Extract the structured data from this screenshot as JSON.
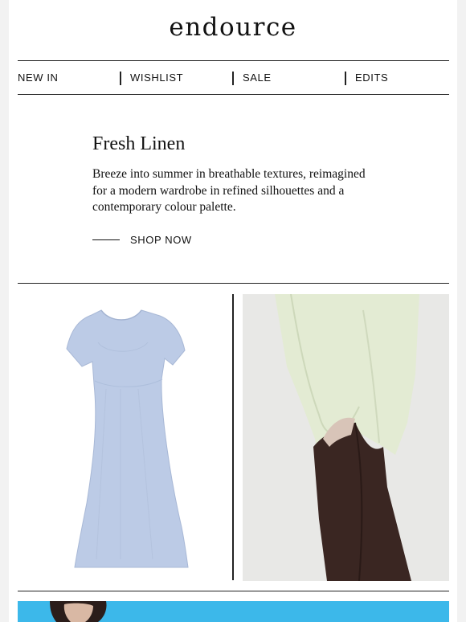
{
  "brand": {
    "logo": "endource"
  },
  "nav": {
    "items": [
      {
        "label": "NEW IN"
      },
      {
        "label": "WISHLIST"
      },
      {
        "label": "SALE"
      },
      {
        "label": "EDITS"
      }
    ]
  },
  "hero": {
    "title": "Fresh Linen",
    "body": "Breeze into summer in breathable textures, reimagined for a modern wardrobe in refined silhouettes and a contemporary colour palette.",
    "cta": "SHOP NOW"
  },
  "products": [
    {
      "image": "blue-linen-midi-dress",
      "color": "#bccbe6"
    },
    {
      "image": "model-pale-green-linen-shirt-brown-trousers",
      "shirt_color": "#e3ebd3",
      "trouser_color": "#3a2622"
    }
  ],
  "banner": {
    "image": "model-portrait-blue-background",
    "color": "#3cb8ea"
  },
  "colors": {
    "text": "#111111",
    "divider": "#222222",
    "page_bg": "#f2f2f2"
  }
}
